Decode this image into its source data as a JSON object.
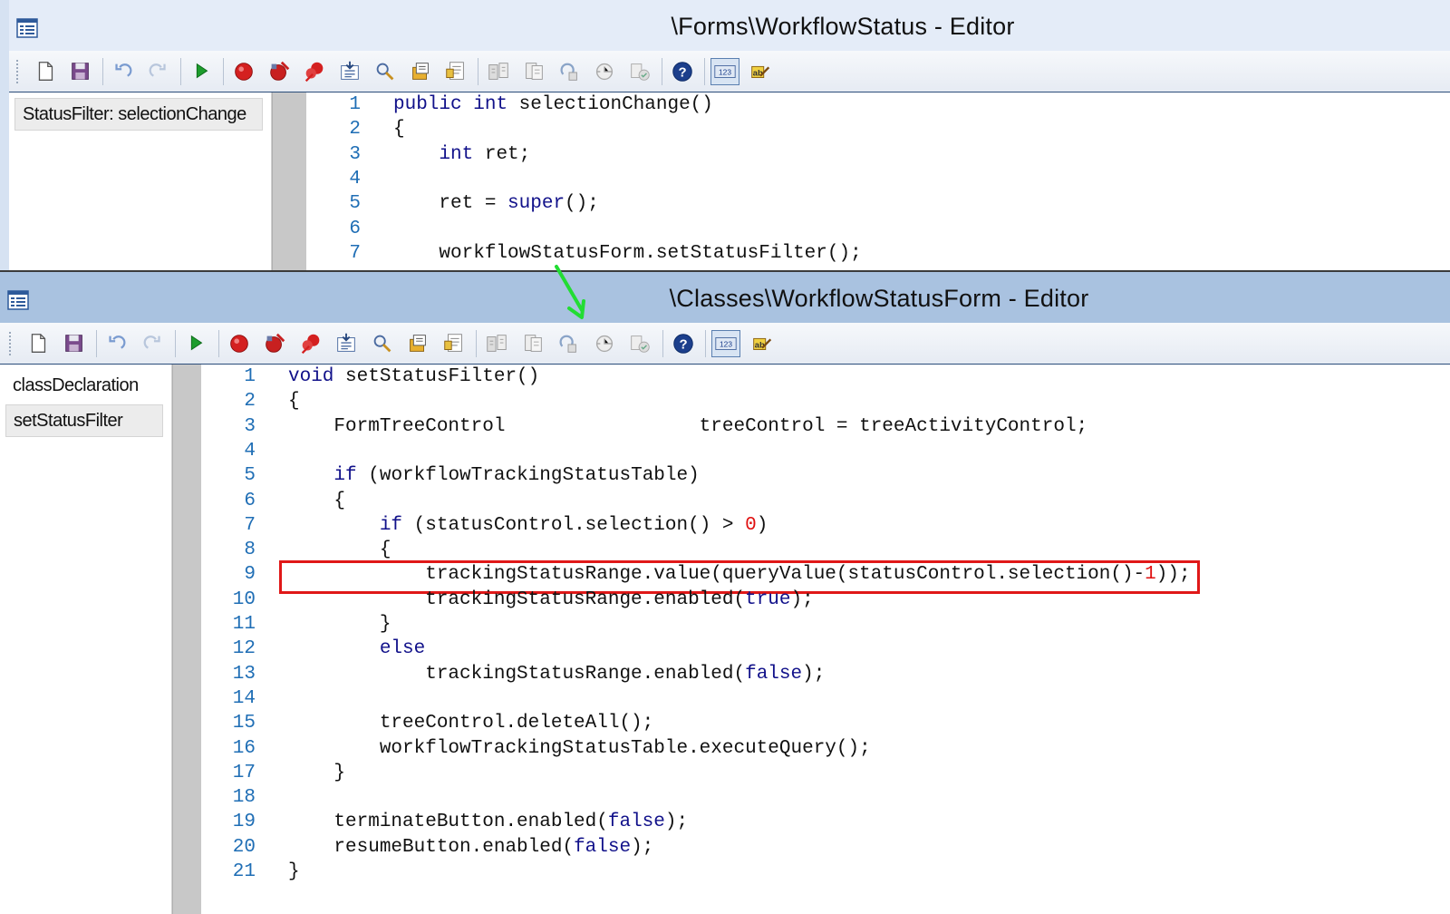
{
  "editor1": {
    "title": "\\Forms\\WorkflowStatus - Editor",
    "methods": [
      "StatusFilter: selectionChange"
    ],
    "lines": [
      {
        "n": "1",
        "parts": [
          {
            "t": "public",
            "c": "kw"
          },
          {
            "t": " "
          },
          {
            "t": "int",
            "c": "kw"
          },
          {
            "t": " selectionChange()"
          }
        ]
      },
      {
        "n": "2",
        "parts": [
          {
            "t": "{"
          }
        ]
      },
      {
        "n": "3",
        "parts": [
          {
            "t": "    "
          },
          {
            "t": "int",
            "c": "kw"
          },
          {
            "t": " ret;"
          }
        ]
      },
      {
        "n": "4",
        "parts": []
      },
      {
        "n": "5",
        "parts": [
          {
            "t": "    ret = "
          },
          {
            "t": "super",
            "c": "kw"
          },
          {
            "t": "();"
          }
        ]
      },
      {
        "n": "6",
        "parts": []
      },
      {
        "n": "7",
        "parts": [
          {
            "t": "    workflowStatusForm.setStatusFilter();"
          }
        ]
      }
    ]
  },
  "editor2": {
    "title": "\\Classes\\WorkflowStatusForm - Editor",
    "methods": [
      "classDeclaration",
      "setStatusFilter"
    ],
    "active_method": 1,
    "highlighted_line": "9",
    "lines": [
      {
        "n": "1",
        "parts": [
          {
            "t": "void",
            "c": "kw"
          },
          {
            "t": " setStatusFilter()"
          }
        ]
      },
      {
        "n": "2",
        "parts": [
          {
            "t": "{"
          }
        ]
      },
      {
        "n": "3",
        "parts": [
          {
            "t": "    FormTreeControl                 treeControl = treeActivityControl;"
          }
        ]
      },
      {
        "n": "4",
        "parts": []
      },
      {
        "n": "5",
        "parts": [
          {
            "t": "    "
          },
          {
            "t": "if",
            "c": "kw"
          },
          {
            "t": " (workflowTrackingStatusTable)"
          }
        ]
      },
      {
        "n": "6",
        "parts": [
          {
            "t": "    {"
          }
        ]
      },
      {
        "n": "7",
        "parts": [
          {
            "t": "        "
          },
          {
            "t": "if",
            "c": "kw"
          },
          {
            "t": " (statusControl.selection() > "
          },
          {
            "t": "0",
            "c": "num"
          },
          {
            "t": ")"
          }
        ]
      },
      {
        "n": "8",
        "parts": [
          {
            "t": "        {"
          }
        ]
      },
      {
        "n": "9",
        "parts": [
          {
            "t": "            trackingStatusRange.value(queryValue(statusControl.selection()-"
          },
          {
            "t": "1",
            "c": "num"
          },
          {
            "t": "));"
          }
        ]
      },
      {
        "n": "10",
        "parts": [
          {
            "t": "            trackingStatusRange.enabled("
          },
          {
            "t": "true",
            "c": "kw"
          },
          {
            "t": ");"
          }
        ]
      },
      {
        "n": "11",
        "parts": [
          {
            "t": "        }"
          }
        ]
      },
      {
        "n": "12",
        "parts": [
          {
            "t": "        "
          },
          {
            "t": "else",
            "c": "kw"
          }
        ]
      },
      {
        "n": "13",
        "parts": [
          {
            "t": "            trackingStatusRange.enabled("
          },
          {
            "t": "false",
            "c": "kw"
          },
          {
            "t": ");"
          }
        ]
      },
      {
        "n": "14",
        "parts": []
      },
      {
        "n": "15",
        "parts": [
          {
            "t": "        treeControl.deleteAll();"
          }
        ]
      },
      {
        "n": "16",
        "parts": [
          {
            "t": "        workflowTrackingStatusTable.executeQuery();"
          }
        ]
      },
      {
        "n": "17",
        "parts": [
          {
            "t": "    }"
          }
        ]
      },
      {
        "n": "18",
        "parts": []
      },
      {
        "n": "19",
        "parts": [
          {
            "t": "    terminateButton.enabled("
          },
          {
            "t": "false",
            "c": "kw"
          },
          {
            "t": ");"
          }
        ]
      },
      {
        "n": "20",
        "parts": [
          {
            "t": "    resumeButton.enabled("
          },
          {
            "t": "false",
            "c": "kw"
          },
          {
            "t": ");"
          }
        ]
      },
      {
        "n": "21",
        "parts": [
          {
            "t": "}"
          }
        ]
      }
    ]
  },
  "toolbar": {
    "buttons": [
      "new-icon",
      "save-icon",
      "undo-icon",
      "redo-icon",
      "run-icon",
      "breakpoint-icon",
      "remove-breakpoints-icon",
      "toggle-breakpoints-icon",
      "compile-icon",
      "find-icon",
      "lookup-icon",
      "properties-icon",
      "compare-icon",
      "object-list-icon",
      "scripts-icon",
      "history-icon",
      "version-control-icon",
      "help-icon",
      "line-numbers-icon",
      "best-practices-icon"
    ]
  },
  "colors": {
    "highlight_box": "#e01818",
    "arrow": "#22dd33",
    "keyword": "#11118a",
    "number": "#e01010",
    "line_number": "#1f6eb5"
  }
}
